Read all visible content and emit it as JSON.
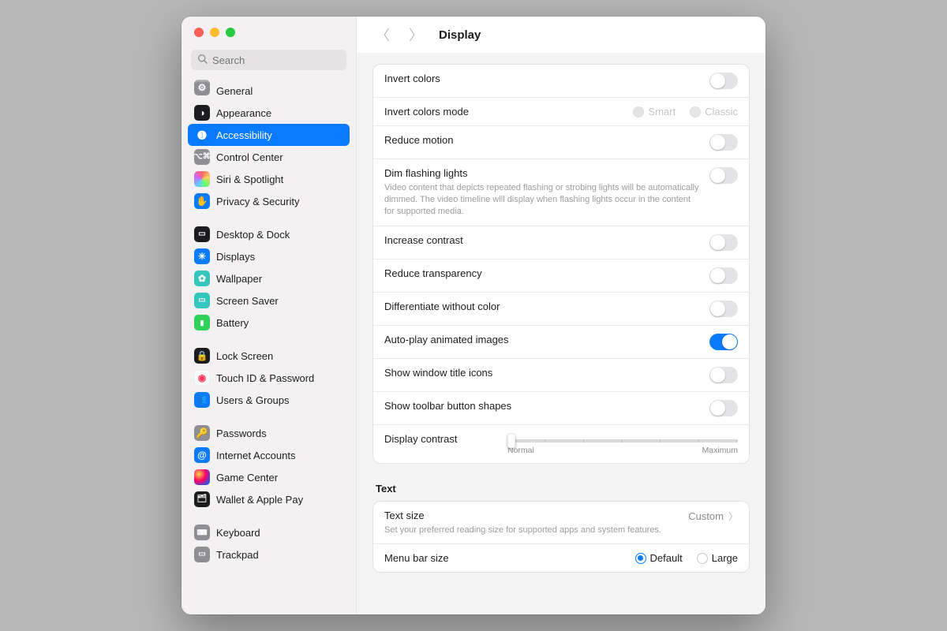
{
  "search": {
    "placeholder": "Search"
  },
  "toolbar": {
    "title": "Display"
  },
  "sidebar": {
    "items": [
      {
        "id": "general",
        "label": "General"
      },
      {
        "id": "appearance",
        "label": "Appearance"
      },
      {
        "id": "accessibility",
        "label": "Accessibility"
      },
      {
        "id": "control-center",
        "label": "Control Center"
      },
      {
        "id": "siri-spotlight",
        "label": "Siri & Spotlight"
      },
      {
        "id": "privacy-security",
        "label": "Privacy & Security"
      },
      {
        "id": "desktop-dock",
        "label": "Desktop & Dock"
      },
      {
        "id": "displays",
        "label": "Displays"
      },
      {
        "id": "wallpaper",
        "label": "Wallpaper"
      },
      {
        "id": "screen-saver",
        "label": "Screen Saver"
      },
      {
        "id": "battery",
        "label": "Battery"
      },
      {
        "id": "lock-screen",
        "label": "Lock Screen"
      },
      {
        "id": "touch-id",
        "label": "Touch ID & Password"
      },
      {
        "id": "users-groups",
        "label": "Users & Groups"
      },
      {
        "id": "passwords",
        "label": "Passwords"
      },
      {
        "id": "internet-accts",
        "label": "Internet Accounts"
      },
      {
        "id": "game-center",
        "label": "Game Center"
      },
      {
        "id": "wallet",
        "label": "Wallet & Apple Pay"
      },
      {
        "id": "keyboard",
        "label": "Keyboard"
      },
      {
        "id": "trackpad",
        "label": "Trackpad"
      }
    ]
  },
  "rows": {
    "invert_colors": {
      "label": "Invert colors",
      "on": false
    },
    "invert_mode": {
      "label": "Invert colors mode",
      "opt_smart": "Smart",
      "opt_classic": "Classic",
      "value": "Smart",
      "disabled": true
    },
    "reduce_motion": {
      "label": "Reduce motion",
      "on": false
    },
    "dim_flashing": {
      "label": "Dim flashing lights",
      "desc": "Video content that depicts repeated flashing or strobing lights will be automatically dimmed. The video timeline will display when flashing lights occur in the content for supported media.",
      "on": false
    },
    "increase_contrast": {
      "label": "Increase contrast",
      "on": false
    },
    "reduce_transparency": {
      "label": "Reduce transparency",
      "on": false
    },
    "diff_without_color": {
      "label": "Differentiate without color",
      "on": false
    },
    "autoplay_animated": {
      "label": "Auto-play animated images",
      "on": true
    },
    "show_title_icons": {
      "label": "Show window title icons",
      "on": false
    },
    "show_toolbar_shapes": {
      "label": "Show toolbar button shapes",
      "on": false
    },
    "display_contrast": {
      "label": "Display contrast",
      "min_label": "Normal",
      "max_label": "Maximum",
      "value": 0
    }
  },
  "text_section": {
    "title": "Text"
  },
  "text_size": {
    "label": "Text size",
    "desc": "Set your preferred reading size for supported apps and system features.",
    "value": "Custom"
  },
  "menu_bar_size": {
    "label": "Menu bar size",
    "opt_default": "Default",
    "opt_large": "Large",
    "value": "Default"
  }
}
